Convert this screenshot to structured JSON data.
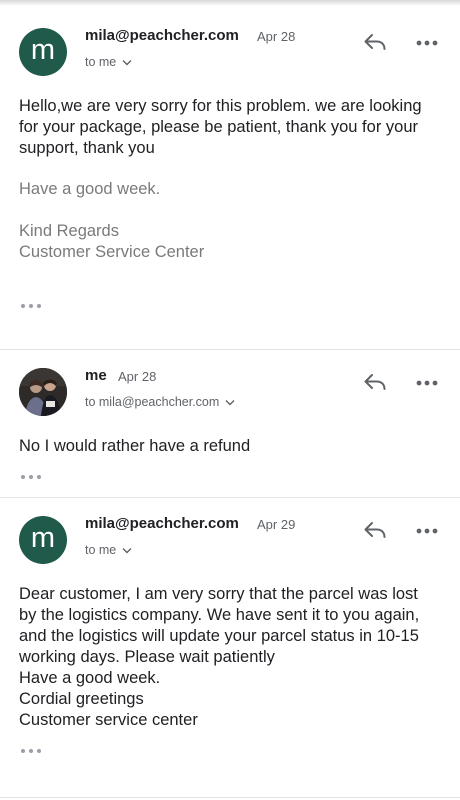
{
  "messages": [
    {
      "avatar_letter": "m",
      "sender": "mila@peachcher.com",
      "date": "Apr 28",
      "to": "to me",
      "body": [
        "Hello,we are very sorry for this problem. we are looking for your package, please be patient, thank you for your support, thank you"
      ],
      "quoted": [
        "Have a good week.",
        "",
        "Kind Regards",
        "Customer Service Center"
      ]
    },
    {
      "avatar_letter": "",
      "sender": "me",
      "date": "Apr 28",
      "to": "to mila@peachcher.com",
      "body": [
        "No I would rather have a refund"
      ]
    },
    {
      "avatar_letter": "m",
      "sender": "mila@peachcher.com",
      "date": "Apr 29",
      "to": "to me",
      "body": [
        "Dear customer, I am very sorry that the parcel was lost by the logistics company. We have sent it to you again, and the logistics will update your parcel status in 10-15 working days. Please wait patiently",
        "Have a good week.",
        "Cordial greetings",
        "Customer service center"
      ]
    }
  ],
  "colors": {
    "avatar_bg": "#1f5a4b",
    "divider": "#e3e3e3",
    "secondary_text": "#5f6368"
  },
  "icons": {
    "reply": "reply-icon",
    "more": "more-icon",
    "expand": "chevron-down-icon",
    "trimmed": "ellipsis-icon"
  }
}
